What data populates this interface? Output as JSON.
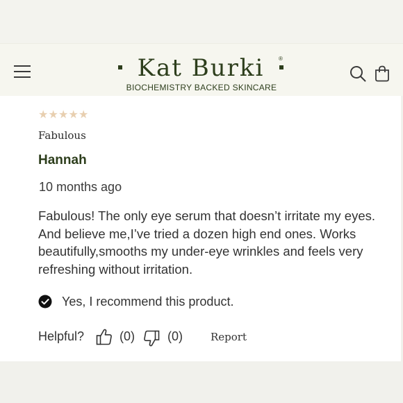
{
  "brand": {
    "name": "Kat Burki",
    "registered_mark": "®",
    "tagline": "BIOCHEMISTRY BACKED  SKINCARE",
    "color": "#2d3e1c"
  },
  "header": {
    "icons": [
      "menu-icon",
      "search-icon",
      "bag-icon"
    ]
  },
  "review": {
    "rating": 5,
    "rating_max": 5,
    "star_color": "#e8cfb0",
    "title": "Fabulous",
    "author": "Hannah",
    "date": "10 months ago",
    "body": "Fabulous! The only eye serum that doesn’t irritate my eyes. And believe me,I’ve tried a dozen high end ones. Works beautifully,smooths my under-eye wrinkles and feels very refreshing without irritation.",
    "recommend_text": "Yes, I recommend this product.",
    "helpful_label": "Helpful?",
    "helpful_up_count": "(0)",
    "helpful_down_count": "(0)",
    "report_label": "Report"
  }
}
